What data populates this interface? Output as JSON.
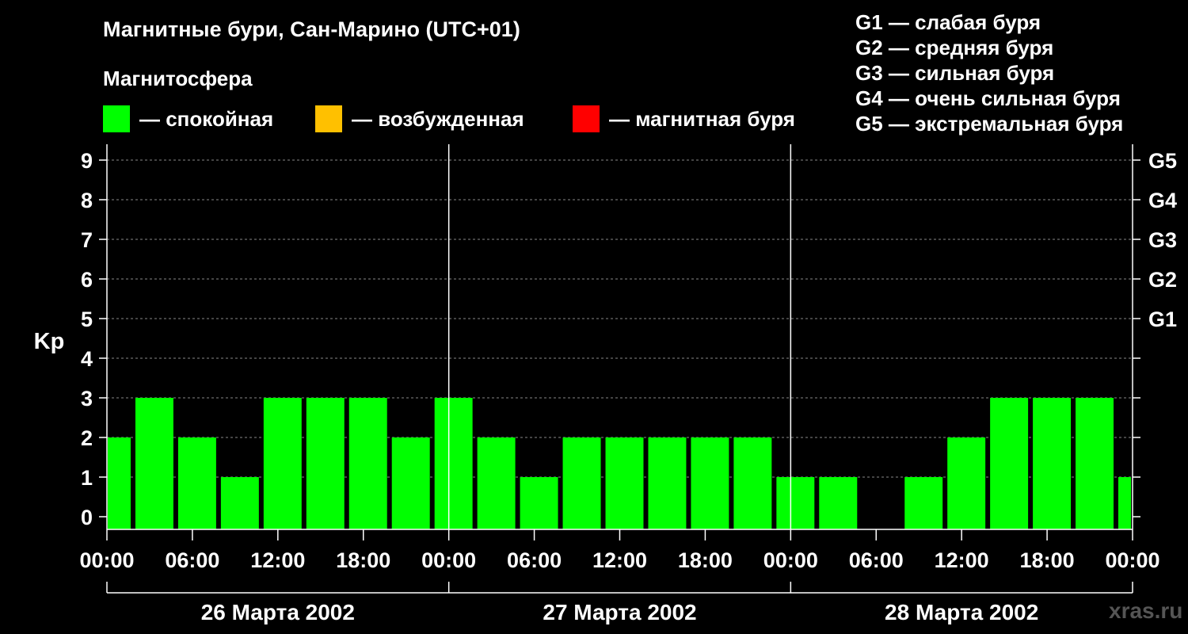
{
  "title": "Магнитные бури, Сан-Марино (UTC+01)",
  "subtitle": "Магнитосфера",
  "legend": [
    {
      "label": "— спокойная",
      "color": "#00ff00"
    },
    {
      "label": "— возбужденная",
      "color": "#ffc000"
    },
    {
      "label": "— магнитная буря",
      "color": "#ff0000"
    }
  ],
  "g_legend": [
    "G1 — слабая буря",
    "G2 — средняя буря",
    "G3 — сильная буря",
    "G4 — очень сильная буря",
    "G5 — экстремальная буря"
  ],
  "watermark": "xras.ru",
  "chart_data": {
    "type": "bar",
    "ylabel": "Kp",
    "ylim": [
      0,
      9
    ],
    "yticks": [
      0,
      1,
      2,
      3,
      4,
      5,
      6,
      7,
      8,
      9
    ],
    "right_ticks": [
      {
        "value": 5,
        "label": "G1"
      },
      {
        "value": 6,
        "label": "G2"
      },
      {
        "value": 7,
        "label": "G3"
      },
      {
        "value": 8,
        "label": "G4"
      },
      {
        "value": 9,
        "label": "G5"
      }
    ],
    "xtick_labels": [
      "00:00",
      "06:00",
      "12:00",
      "18:00",
      "00:00",
      "06:00",
      "12:00",
      "18:00",
      "00:00",
      "06:00",
      "12:00",
      "18:00",
      "00:00"
    ],
    "days": [
      "26 Марта 2002",
      "27 Марта 2002",
      "28 Марта 2002"
    ],
    "bar_hours_start": [
      -1,
      2,
      5,
      8,
      11,
      14,
      17,
      20,
      23,
      26,
      29,
      32,
      35,
      38,
      41,
      44,
      47,
      50,
      53,
      56,
      59,
      62,
      65,
      68,
      71
    ],
    "values": [
      2,
      3,
      2,
      1,
      3,
      3,
      3,
      2,
      3,
      2,
      1,
      2,
      2,
      2,
      2,
      2,
      1,
      1,
      0,
      1,
      2,
      3,
      3,
      3,
      1
    ],
    "grid": true,
    "colors": {
      "quiet": "#00ff00",
      "active": "#ffc000",
      "storm": "#ff0000"
    }
  }
}
